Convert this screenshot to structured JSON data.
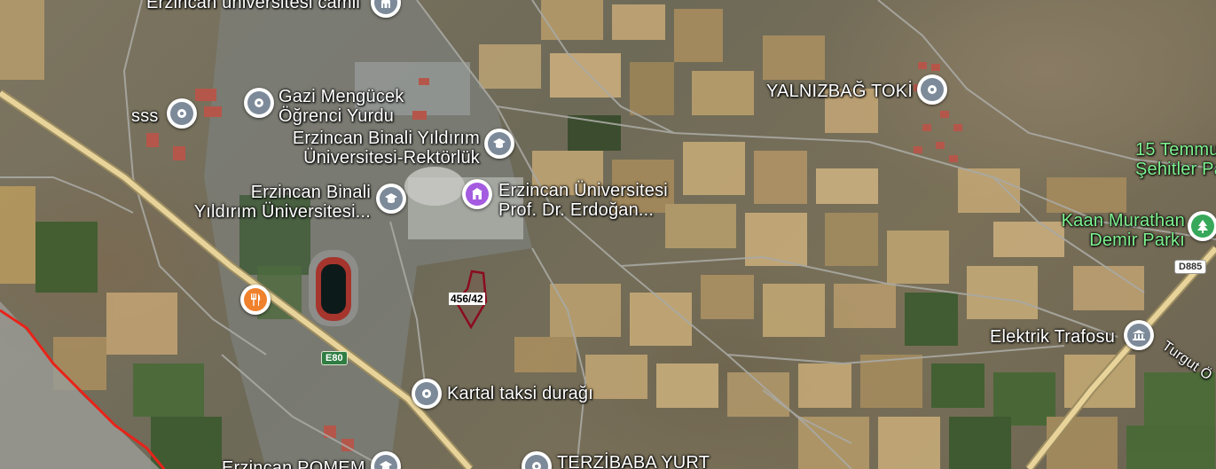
{
  "parcel": {
    "label": "456/42",
    "color": "#8b0c1f"
  },
  "road_shields": {
    "e80": "E80",
    "d885": "D885"
  },
  "labels": {
    "camii": "Erzincan üniversitesi camii",
    "sss": "sss",
    "gazi_line1": "Gazi Mengücek",
    "gazi_line2": "Öğrenci Yurdu",
    "binali_rektorluk_line1": "Erzincan Binali Yıldırım",
    "binali_rektorluk_line2": "Üniversitesi-Rektörlük",
    "binali_uni_line1": "Erzincan Binali",
    "binali_uni_line2": "Yıldırım Üniversitesi...",
    "erdogan_line1": "Erzincan Üniversitesi",
    "erdogan_line2": "Prof. Dr. Erdoğan...",
    "yalnizbag": "YALNIZBAĞ TOKİ",
    "temmuz_line1": "15 Temmu",
    "temmuz_line2": "Şehitler Pa",
    "kaan_line1": "Kaan Murathan",
    "kaan_line2": "Demir Parkı",
    "elektrik": "Elektrik Trafosu",
    "turgut": "Turgut Ö",
    "kartal": "Kartal taksi durağı",
    "pomem": "Erzincan POMEM",
    "terzibaba": "TERZİBABA YURT"
  },
  "icons": {
    "mosque": "mosque-icon",
    "location": "location-pin-icon",
    "school": "school-icon",
    "university": "university-icon",
    "restaurant": "restaurant-icon",
    "park": "tree-icon",
    "landmark": "landmark-icon"
  },
  "colors": {
    "poi_gray": "#7d8a99",
    "university_purple": "#a45be0",
    "restaurant_orange": "#f0812d",
    "park_green": "#37a85a",
    "highway_yellow": "#e8d49a",
    "boundary_red": "#e8231a"
  }
}
